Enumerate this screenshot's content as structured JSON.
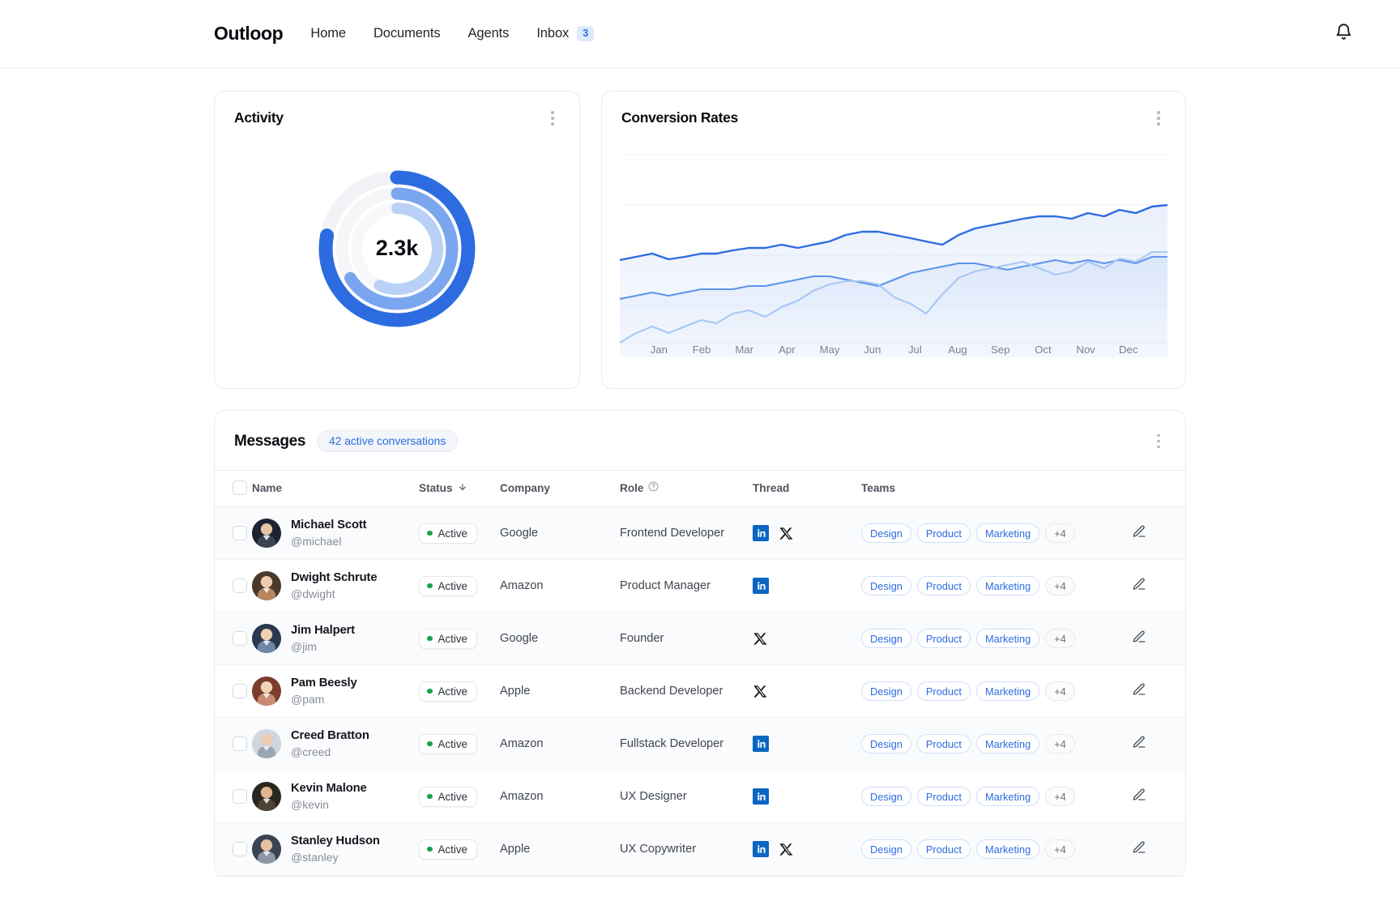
{
  "nav": {
    "brand": "Outloop",
    "links": [
      {
        "label": "Home"
      },
      {
        "label": "Documents"
      },
      {
        "label": "Agents"
      },
      {
        "label": "Inbox",
        "badge": "3"
      }
    ],
    "bell_icon": "bell-icon"
  },
  "activity": {
    "title": "Activity",
    "center_value": "2.3k",
    "menu_icon": "kebab-icon"
  },
  "conversion": {
    "title": "Conversion Rates",
    "menu_icon": "kebab-icon"
  },
  "messages": {
    "title": "Messages",
    "badge": "42 active conversations",
    "menu_icon": "kebab-icon",
    "columns": {
      "name": "Name",
      "status": "Status",
      "company": "Company",
      "role": "Role",
      "thread": "Thread",
      "teams": "Teams"
    },
    "sort_icon": "arrow-down-icon",
    "help_icon": "help-circle-icon",
    "rows": [
      {
        "name": "Michael Scott",
        "handle": "@michael",
        "status": "Active",
        "company": "Google",
        "role": "Frontend Developer",
        "threads": [
          "linkedin",
          "x"
        ],
        "teams": [
          "Design",
          "Product",
          "Marketing"
        ],
        "teams_more": "+4"
      },
      {
        "name": "Dwight Schrute",
        "handle": "@dwight",
        "status": "Active",
        "company": "Amazon",
        "role": "Product Manager",
        "threads": [
          "linkedin"
        ],
        "teams": [
          "Design",
          "Product",
          "Marketing"
        ],
        "teams_more": "+4"
      },
      {
        "name": "Jim Halpert",
        "handle": "@jim",
        "status": "Active",
        "company": "Google",
        "role": "Founder",
        "threads": [
          "x"
        ],
        "teams": [
          "Design",
          "Product",
          "Marketing"
        ],
        "teams_more": "+4"
      },
      {
        "name": "Pam Beesly",
        "handle": "@pam",
        "status": "Active",
        "company": "Apple",
        "role": "Backend Developer",
        "threads": [
          "x"
        ],
        "teams": [
          "Design",
          "Product",
          "Marketing"
        ],
        "teams_more": "+4"
      },
      {
        "name": "Creed Bratton",
        "handle": "@creed",
        "status": "Active",
        "company": "Amazon",
        "role": "Fullstack Developer",
        "threads": [
          "linkedin"
        ],
        "teams": [
          "Design",
          "Product",
          "Marketing"
        ],
        "teams_more": "+4"
      },
      {
        "name": "Kevin Malone",
        "handle": "@kevin",
        "status": "Active",
        "company": "Amazon",
        "role": "UX Designer",
        "threads": [
          "linkedin"
        ],
        "teams": [
          "Design",
          "Product",
          "Marketing"
        ],
        "teams_more": "+4"
      },
      {
        "name": "Stanley Hudson",
        "handle": "@stanley",
        "status": "Active",
        "company": "Apple",
        "role": "UX Copywriter",
        "threads": [
          "linkedin",
          "x"
        ],
        "teams": [
          "Design",
          "Product",
          "Marketing"
        ],
        "teams_more": "+4"
      }
    ]
  },
  "colors": {
    "accent": "#2d6ce0",
    "accent_mid": "#74a3ee",
    "accent_light": "#b9d1f6",
    "track": "#f1f3f6",
    "status_green": "#16a34a",
    "linkedin": "#0a66c2"
  },
  "chart_data": [
    {
      "type": "pie",
      "title": "Activity",
      "center_label": "2.3k",
      "rings": [
        {
          "name": "outer",
          "percent": 78,
          "color": "#2d6ce0"
        },
        {
          "name": "middle",
          "percent": 66,
          "color": "#7aa6ef"
        },
        {
          "name": "inner",
          "percent": 57,
          "color": "#b9d1f6"
        }
      ],
      "track_color": "#f1f3f6"
    },
    {
      "type": "area",
      "title": "Conversion Rates",
      "xlabel": "",
      "ylabel": "",
      "grid": true,
      "legend": "none",
      "categories": [
        "Jan",
        "Feb",
        "Mar",
        "Apr",
        "May",
        "Jun",
        "Jul",
        "Aug",
        "Sep",
        "Oct",
        "Nov",
        "Dec"
      ],
      "x": [
        0,
        1,
        2,
        3,
        4,
        5,
        6,
        7,
        8,
        9,
        10,
        11
      ],
      "ylim": [
        0,
        100
      ],
      "series": [
        {
          "name": "Series 1",
          "color": "#2d6ce0",
          "values": [
            56,
            58,
            57,
            59,
            60,
            61,
            63,
            62,
            64,
            66,
            68,
            72
          ],
          "points": [
            56,
            57,
            58,
            56,
            57,
            58,
            58,
            59,
            60,
            60,
            61,
            60,
            61,
            62,
            64,
            65,
            65,
            64,
            63,
            62,
            61,
            64,
            66,
            67,
            68,
            69,
            70,
            70,
            69,
            71,
            70,
            72,
            71,
            73
          ]
        },
        {
          "name": "Series 2",
          "color": "#5d94ea",
          "values": [
            36,
            37,
            38,
            38,
            39,
            41,
            42,
            40,
            43,
            45,
            46,
            47
          ],
          "points": [
            35,
            36,
            37,
            36,
            37,
            38,
            38,
            38,
            39,
            39,
            40,
            41,
            42,
            42,
            41,
            40,
            39,
            41,
            43,
            44,
            45,
            46,
            46,
            45,
            44,
            45,
            46,
            47,
            46,
            47,
            46,
            47,
            46,
            48
          ]
        },
        {
          "name": "Series 3",
          "color": "#a8c8f3",
          "values": [
            10,
            12,
            13,
            16,
            18,
            24,
            27,
            21,
            29,
            33,
            31,
            36
          ],
          "points": [
            8,
            11,
            13,
            11,
            13,
            15,
            14,
            17,
            18,
            16,
            19,
            21,
            24,
            26,
            27,
            27,
            26,
            22,
            20,
            17,
            23,
            28,
            30,
            31,
            32,
            33,
            31,
            29,
            30,
            33,
            31,
            34,
            33,
            36
          ]
        }
      ]
    }
  ]
}
